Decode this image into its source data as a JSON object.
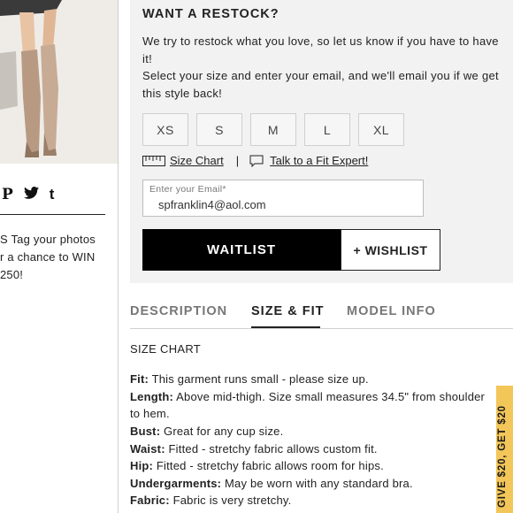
{
  "restock": {
    "title": "WANT A RESTOCK?",
    "line1": "We try to restock what you love, so let us know if you have to have it!",
    "line2": "Select your size and enter your email, and we'll email you if we get this style back!",
    "sizes": [
      "XS",
      "S",
      "M",
      "L",
      "XL"
    ],
    "size_chart_link": "Size Chart",
    "separator": "|",
    "fit_expert_link": "Talk to a Fit Expert!",
    "email_label": "Enter your Email*",
    "email_value": "spfranklin4@aol.com",
    "waitlist_label": "WAITLIST",
    "wishlist_label": "+ WISHLIST"
  },
  "left": {
    "share_icons": [
      "pinterest-icon",
      "twitter-icon",
      "tumblr-icon"
    ],
    "share_glyphs": [
      "P",
      "t"
    ],
    "promo_line1": "S  Tag your photos",
    "promo_line2": "r a chance to WIN",
    "promo_line3": "250!"
  },
  "tabs": {
    "description": "DESCRIPTION",
    "size_fit": "SIZE & FIT",
    "model_info": "MODEL INFO",
    "active": "SIZE & FIT"
  },
  "size_fit": {
    "heading": "SIZE CHART",
    "items": [
      {
        "label": "Fit:",
        "text": "This garment runs small - please size up."
      },
      {
        "label": "Length:",
        "text": "Above mid-thigh. Size small measures 34.5\" from shoulder"
      },
      {
        "label": "",
        "text": "to hem."
      },
      {
        "label": "Bust:",
        "text": "Great for any cup size."
      },
      {
        "label": "Waist:",
        "text": "Fitted - stretchy fabric allows custom fit."
      },
      {
        "label": "Hip:",
        "text": "Fitted - stretchy fabric allows room for hips."
      },
      {
        "label": "Undergarments:",
        "text": "May be worn with any standard bra."
      },
      {
        "label": "Fabric:",
        "text": "Fabric is very stretchy."
      }
    ]
  },
  "side_tab": {
    "label": "GIVE $20, GET $20"
  },
  "colors": {
    "panel_bg": "#f2f2f2",
    "waitlist_bg": "#000000",
    "side_tab_bg": "#f3c65a"
  }
}
